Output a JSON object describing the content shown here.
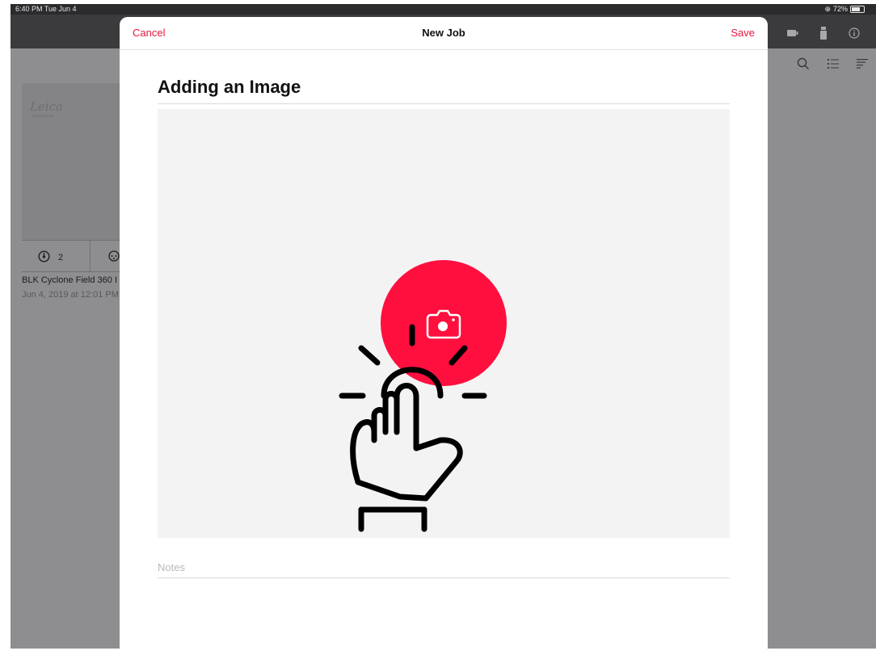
{
  "status_bar": {
    "time": "6:40 PM  Tue Jun 4",
    "battery": "72%"
  },
  "background_list": {
    "card": {
      "logo": "Leica",
      "logo_sub": "Geosystems",
      "setups_count": "2",
      "title": "BLK Cyclone Field 360 I",
      "date": "Jun 4, 2019 at 12:01 PM"
    }
  },
  "modal": {
    "cancel_label": "Cancel",
    "title": "New Job",
    "save_label": "Save",
    "field_title": "Adding an Image",
    "notes_placeholder": "Notes",
    "notes_value": ""
  },
  "colors": {
    "accent": "#e8153f",
    "camera_circle": "#ff0f3e",
    "overlay": "#8e8e91"
  },
  "icons": [
    "camera-icon",
    "tap-hand-icon",
    "search-icon",
    "list-icon",
    "sort-icon",
    "battery-icon",
    "device-icon",
    "info-icon",
    "clock-icon",
    "setups-icon"
  ]
}
